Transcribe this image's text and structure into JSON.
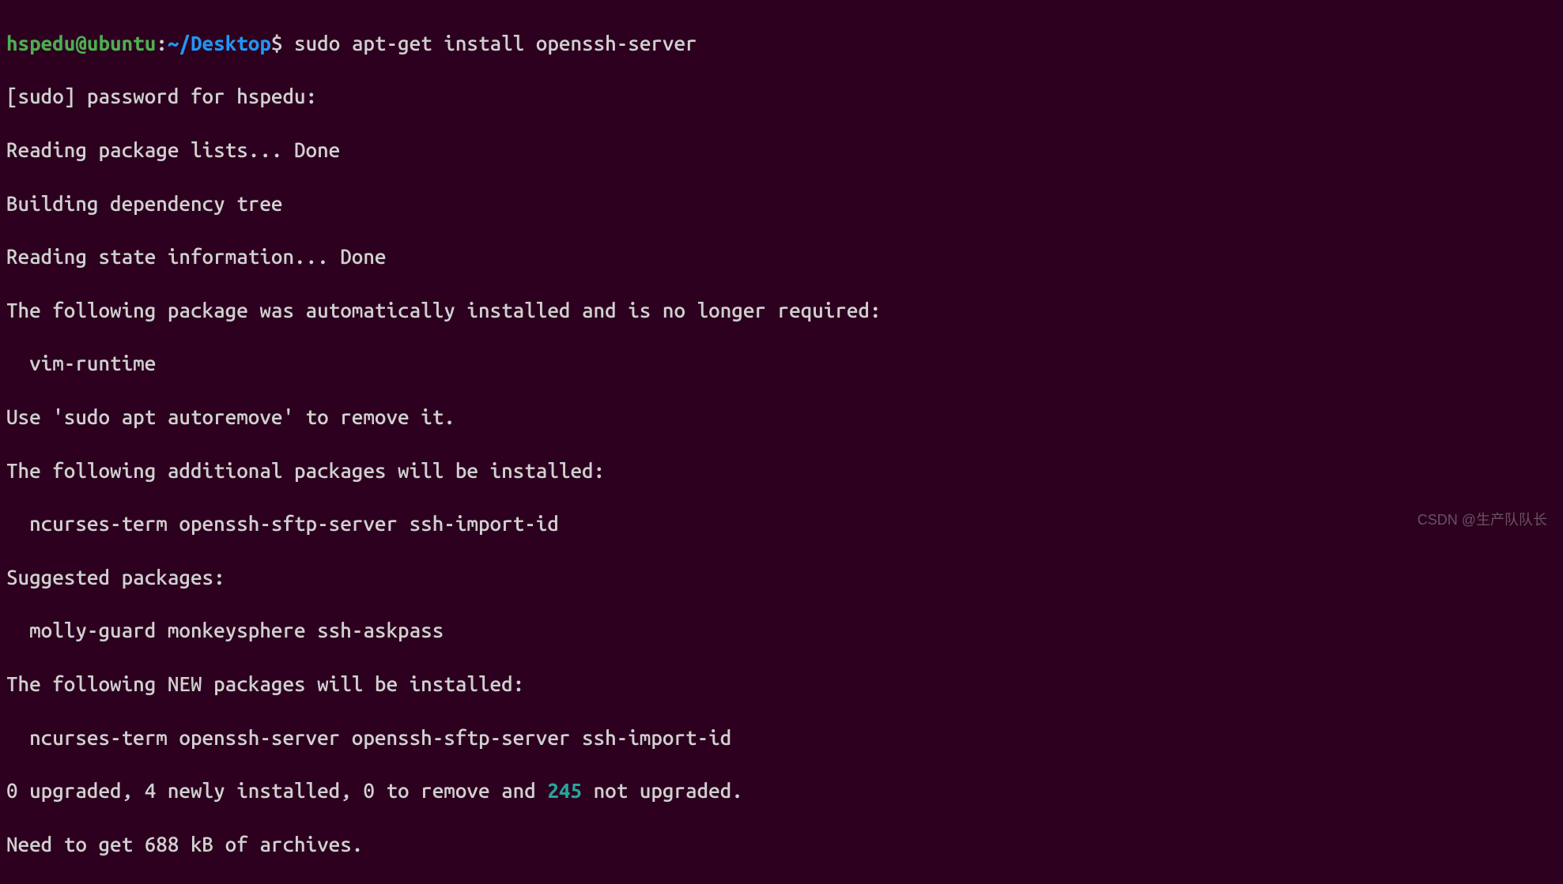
{
  "prompt": {
    "user_host": "hspedu@ubuntu",
    "colon": ":",
    "path": "~/Desktop",
    "dollar": "$ ",
    "command": "sudo apt-get install openssh-server"
  },
  "lines": {
    "l1": "[sudo] password for hspedu:",
    "l2": "Reading package lists... Done",
    "l3": "Building dependency tree",
    "l4": "Reading state information... Done",
    "l5": "The following package was automatically installed and is no longer required:",
    "l6": "  vim-runtime",
    "l7": "Use 'sudo apt autoremove' to remove it.",
    "l8": "The following additional packages will be installed:",
    "l9": "  ncurses-term openssh-sftp-server ssh-import-id",
    "l10": "Suggested packages:",
    "l11": "  molly-guard monkeysphere ssh-askpass",
    "l12": "The following NEW packages will be installed:",
    "l13": "  ncurses-term openssh-server openssh-sftp-server ssh-import-id",
    "l14_a": "0 upgraded, 4 newly installed, 0 to remove and ",
    "l14_num": "245",
    "l14_b": " not upgraded.",
    "l15": "Need to get 688 kB of archives."
  },
  "watermark": "CSDN @生产队队长"
}
